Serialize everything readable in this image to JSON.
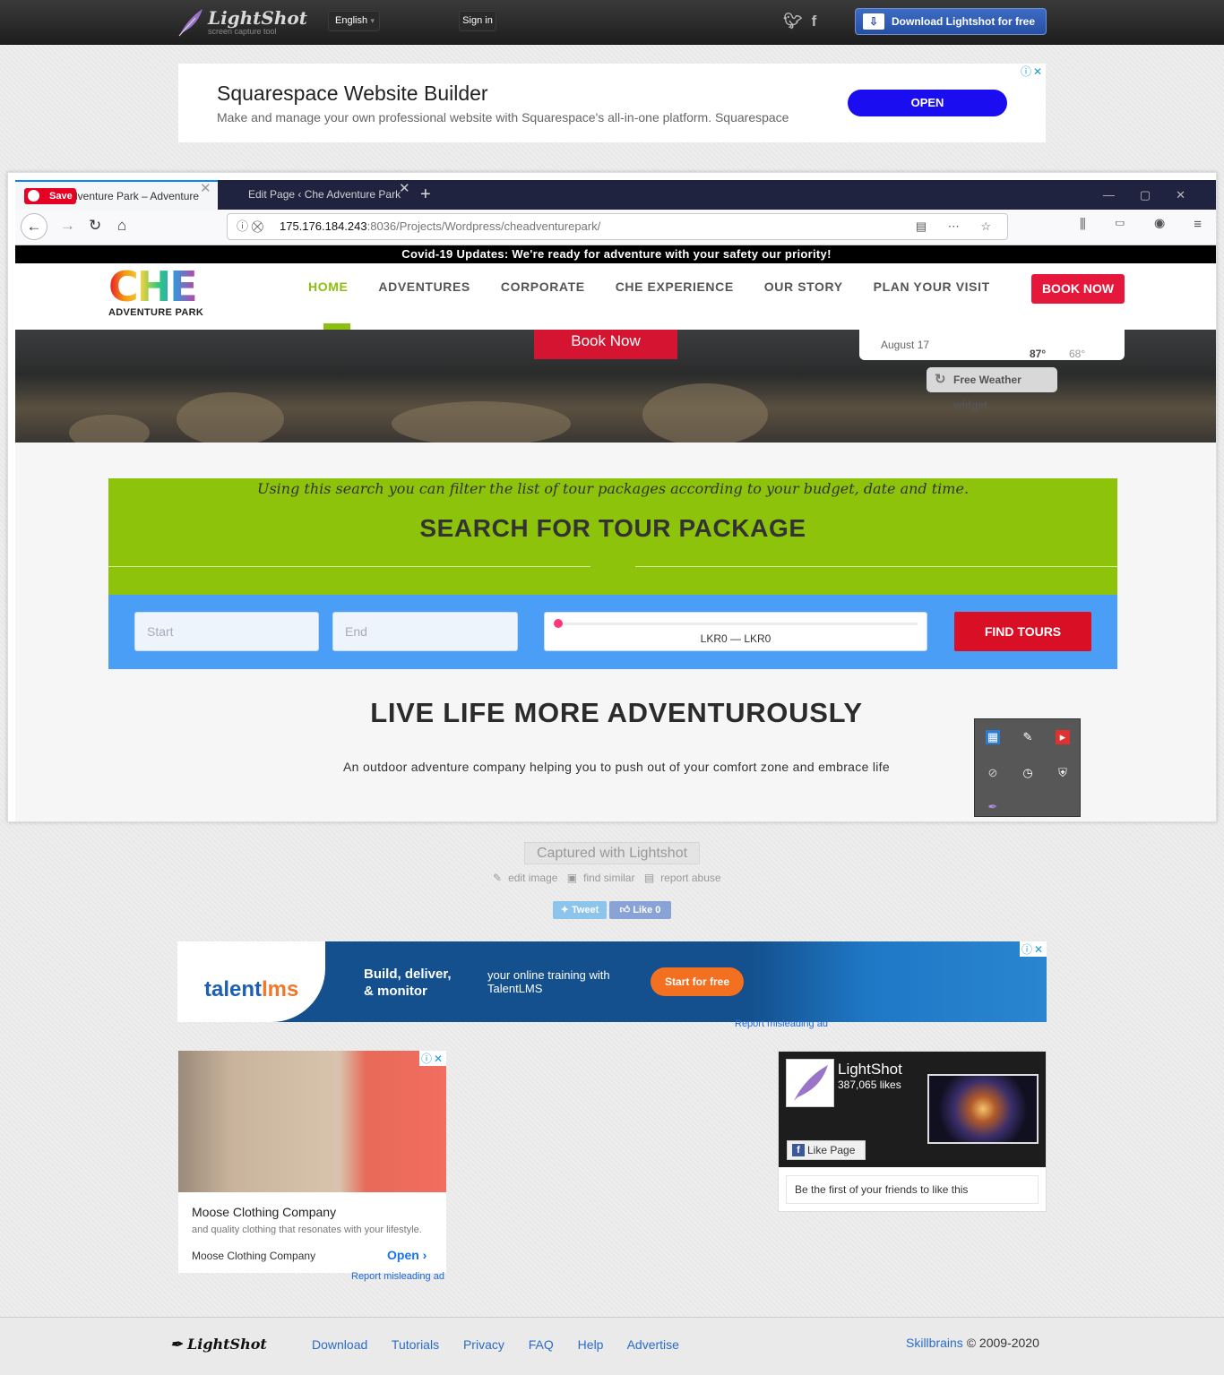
{
  "header": {
    "logo_name": "LightShot",
    "logo_tagline": "screen capture tool",
    "language": "English",
    "signin": "Sign in",
    "download": "Download Lightshot for free"
  },
  "ad_top": {
    "title": "Squarespace Website Builder",
    "desc": "Make and manage your own professional website with Squarespace's all-in-one platform. Squarespace",
    "button": "OPEN"
  },
  "screenshot": {
    "tabs": [
      {
        "label": "Adventure Park – Adventure"
      },
      {
        "label": "Edit Page ‹ Che Adventure Park"
      }
    ],
    "pin_save": "Save",
    "url_host": "175.176.184.243",
    "url_path": ":8036/Projects/Wordpress/cheadventurepark/",
    "covid": "Covid-19 Updates: We're ready for adventure with your safety our priority!",
    "site_logo": "CHE",
    "site_logo_sub": "ADVENTURE PARK",
    "menu": [
      "HOME",
      "ADVENTURES",
      "CORPORATE",
      "CHE EXPERIENCE",
      "OUR STORY",
      "PLAN YOUR VISIT"
    ],
    "book_now": "BOOK NOW",
    "hero_book": "Book Now",
    "weather_date": "August 17",
    "weather_hi": "87°",
    "weather_lo": "68°",
    "weather_widget": "Free Weather widget",
    "search_intro": "Using this search you can filter the list of tour packages according to your budget, date and time.",
    "search_title": "SEARCH FOR TOUR PACKAGE",
    "start_placeholder": "Start",
    "end_placeholder": "End",
    "range_value": "LKR0 — LKR0",
    "find_tours": "FIND TOURS",
    "live_title": "LIVE LIFE MORE ADVENTUROUSLY",
    "live_sub": "An outdoor adventure company helping you to push out of your comfort zone and embrace life"
  },
  "captured": "Captured with Lightshot",
  "actions": [
    "edit image",
    "find similar",
    "report abuse"
  ],
  "tweet": "Tweet",
  "like": "Like 0",
  "ad_talent": {
    "logo": "talent",
    "logo_b": "lms",
    "headline": "Build, deliver, & monitor",
    "sub": "your online training with TalentLMS",
    "button": "Start for free",
    "report": "Report misleading ad"
  },
  "ad_moose": {
    "title": "Moose Clothing Company",
    "desc": "and quality clothing that resonates with your lifestyle.",
    "name": "Moose Clothing Company",
    "open": "Open",
    "report": "Report misleading ad"
  },
  "fb": {
    "name": "LightShot",
    "likes": "387,065 likes",
    "like_page": "Like Page",
    "friends": "Be the first of your friends to like this"
  },
  "footer": {
    "logo": "LightShot",
    "links": [
      "Download",
      "Tutorials",
      "Privacy",
      "FAQ",
      "Help",
      "Advertise"
    ],
    "company": "Skillbrains",
    "copyright": "© 2009-2020"
  }
}
